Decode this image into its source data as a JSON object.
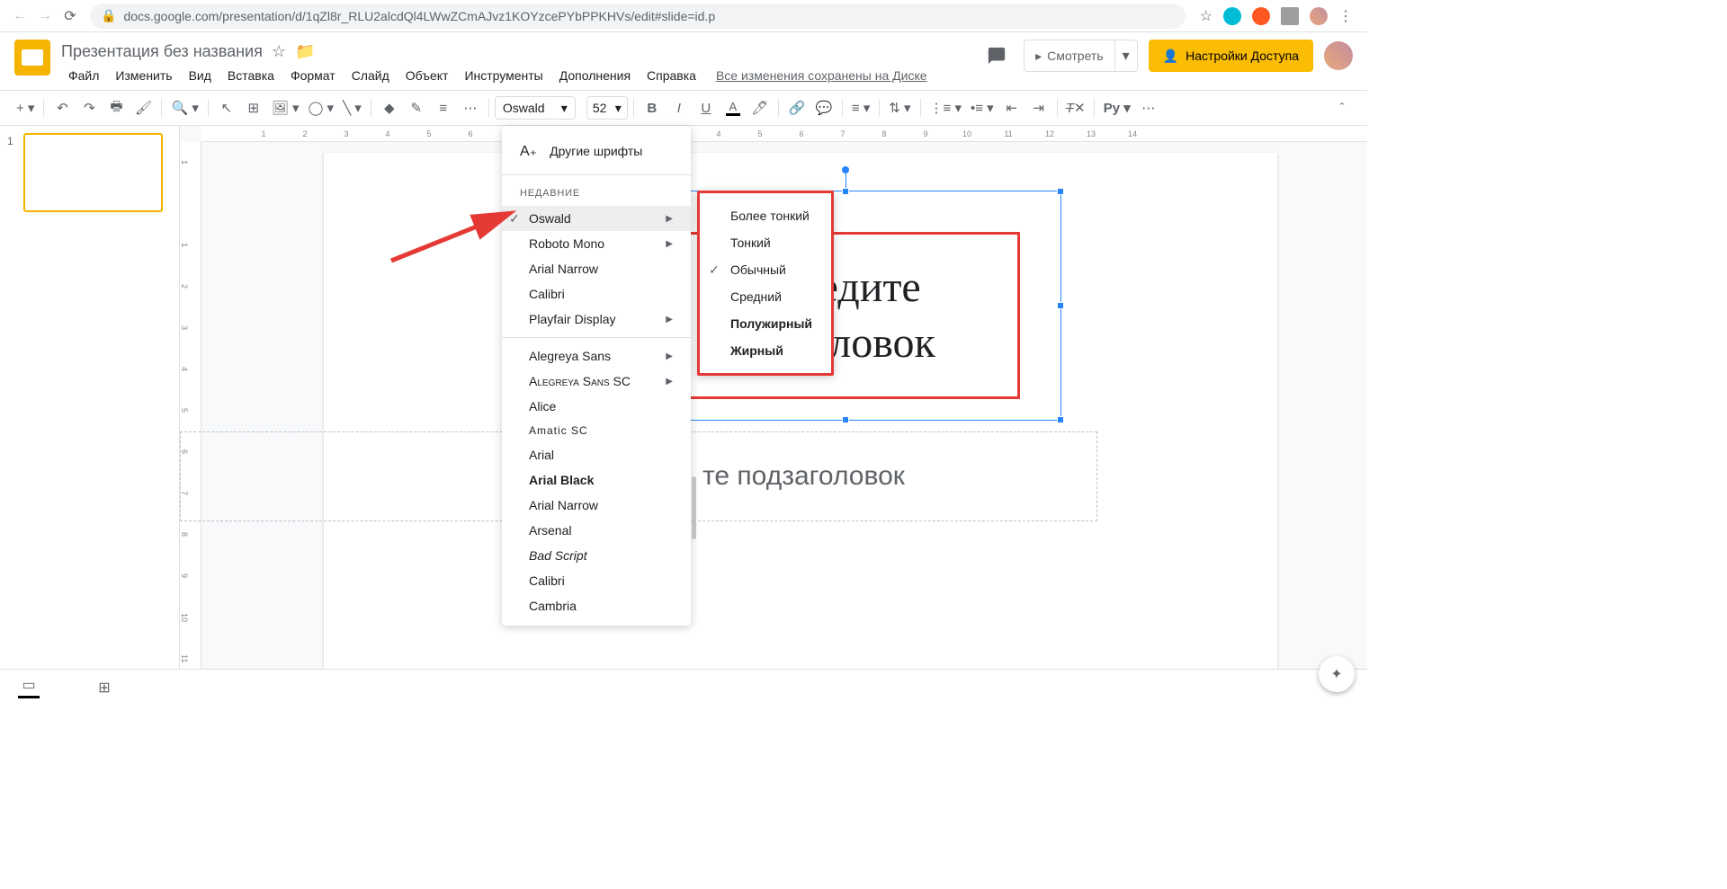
{
  "browser": {
    "url": "docs.google.com/presentation/d/1qZl8r_RLU2alcdQl4LWwZCmAJvz1KOYzcePYbPPKHVs/edit#slide=id.p"
  },
  "header": {
    "doc_title": "Презентация без названия",
    "menus": [
      "Файл",
      "Изменить",
      "Вид",
      "Вставка",
      "Формат",
      "Слайд",
      "Объект",
      "Инструменты",
      "Дополнения",
      "Справка"
    ],
    "save_status": "Все изменения сохранены на Диске",
    "present_label": "Смотреть",
    "share_label": "Настройки Доступа"
  },
  "toolbar": {
    "font_name": "Oswald",
    "font_size": "52"
  },
  "font_menu": {
    "more_fonts": "Другие шрифты",
    "recent_header": "НЕДАВНИЕ",
    "recent": [
      {
        "label": "Oswald",
        "checked": true,
        "submenu": true,
        "cls": "ff-oswald",
        "highlighted": true
      },
      {
        "label": "Roboto Mono",
        "checked": false,
        "submenu": true,
        "cls": "ff-roboto-mono"
      },
      {
        "label": "Arial Narrow",
        "checked": false,
        "submenu": false,
        "cls": ""
      },
      {
        "label": "Calibri",
        "checked": false,
        "submenu": false,
        "cls": ""
      },
      {
        "label": "Playfair Display",
        "checked": false,
        "submenu": true,
        "cls": "ff-playfair"
      }
    ],
    "all": [
      {
        "label": "Alegreya Sans",
        "submenu": true,
        "cls": ""
      },
      {
        "label": "Alegreya Sans SC",
        "submenu": true,
        "cls": "ff-alegreya-sc"
      },
      {
        "label": "Alice",
        "submenu": false,
        "cls": "ff-alice"
      },
      {
        "label": "Amatic SC",
        "submenu": false,
        "cls": "ff-amatic"
      },
      {
        "label": "Arial",
        "submenu": false,
        "cls": ""
      },
      {
        "label": "Arial Black",
        "submenu": false,
        "cls": "ff-arial-black"
      },
      {
        "label": "Arial Narrow",
        "submenu": false,
        "cls": ""
      },
      {
        "label": "Arsenal",
        "submenu": false,
        "cls": ""
      },
      {
        "label": "Bad Script",
        "submenu": false,
        "cls": "ff-bad-script"
      },
      {
        "label": "Calibri",
        "submenu": false,
        "cls": ""
      },
      {
        "label": "Cambria",
        "submenu": false,
        "cls": "ff-cambria"
      }
    ]
  },
  "font_submenu": {
    "weights": [
      {
        "label": "Более тонкий",
        "weight": 200,
        "checked": false
      },
      {
        "label": "Тонкий",
        "weight": 300,
        "checked": false
      },
      {
        "label": "Обычный",
        "weight": 400,
        "checked": true
      },
      {
        "label": "Средний",
        "weight": 500,
        "checked": false
      },
      {
        "label": "Полужирный",
        "weight": 600,
        "checked": false
      },
      {
        "label": "Жирный",
        "weight": 700,
        "checked": false
      }
    ]
  },
  "slide": {
    "number": "1",
    "title_line1": "Введите",
    "title_line2": "заголовок",
    "subtitle": "те подзаголовок"
  },
  "ruler_h": [
    "",
    "1",
    "2",
    "3",
    "4",
    "5",
    "6",
    "",
    "",
    "1",
    "2",
    "3",
    "4",
    "5",
    "6",
    "7",
    "8",
    "9",
    "10",
    "11",
    "12",
    "13",
    "14",
    ""
  ],
  "ruler_v": [
    "1",
    "",
    "1",
    "2",
    "3",
    "4",
    "5",
    "6",
    "7",
    "8",
    "9",
    "10",
    "11"
  ]
}
